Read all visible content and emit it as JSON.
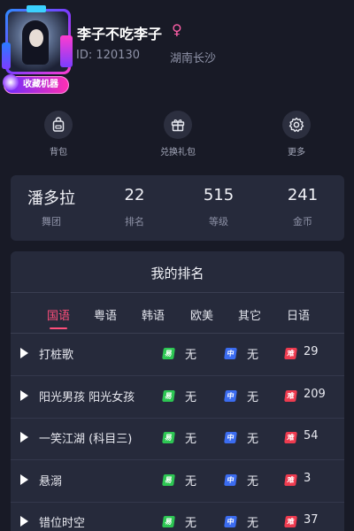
{
  "profile": {
    "username": "李子不吃李子",
    "gender_symbol": "♀",
    "uid": "ID: 120130",
    "location": "湖南长沙",
    "avatar_badge": "收藏机器"
  },
  "quick_actions": [
    {
      "label": "背包",
      "icon": "backpack-icon"
    },
    {
      "label": "兑换礼包",
      "icon": "gift-icon"
    },
    {
      "label": "更多",
      "icon": "gear-icon"
    }
  ],
  "stats": [
    {
      "value": "潘多拉",
      "label": "舞团"
    },
    {
      "value": "22",
      "label": "排名"
    },
    {
      "value": "515",
      "label": "等级"
    },
    {
      "value": "241",
      "label": "金币"
    }
  ],
  "ranking": {
    "title": "我的排名",
    "tabs": [
      "国语",
      "粤语",
      "韩语",
      "欧美",
      "其它",
      "日语"
    ],
    "active_tab": 0,
    "difficulty_labels": {
      "easy": "易",
      "mid": "中",
      "hard": "难"
    },
    "songs": [
      {
        "title": "打桩歌",
        "easy": "无",
        "mid": "无",
        "hard": "29"
      },
      {
        "title": "阳光男孩 阳光女孩",
        "easy": "无",
        "mid": "无",
        "hard": "209"
      },
      {
        "title": "一笑江湖 (科目三)",
        "easy": "无",
        "mid": "无",
        "hard": "54"
      },
      {
        "title": "悬溺",
        "easy": "无",
        "mid": "无",
        "hard": "3"
      },
      {
        "title": "错位时空",
        "easy": "无",
        "mid": "无",
        "hard": "37"
      }
    ]
  },
  "colors": {
    "background": "#181a26",
    "card": "#262a3b",
    "accent": "#ff4f7b",
    "easy": "#2dc653",
    "mid": "#3b6cf0",
    "hard": "#ee3b4f"
  }
}
